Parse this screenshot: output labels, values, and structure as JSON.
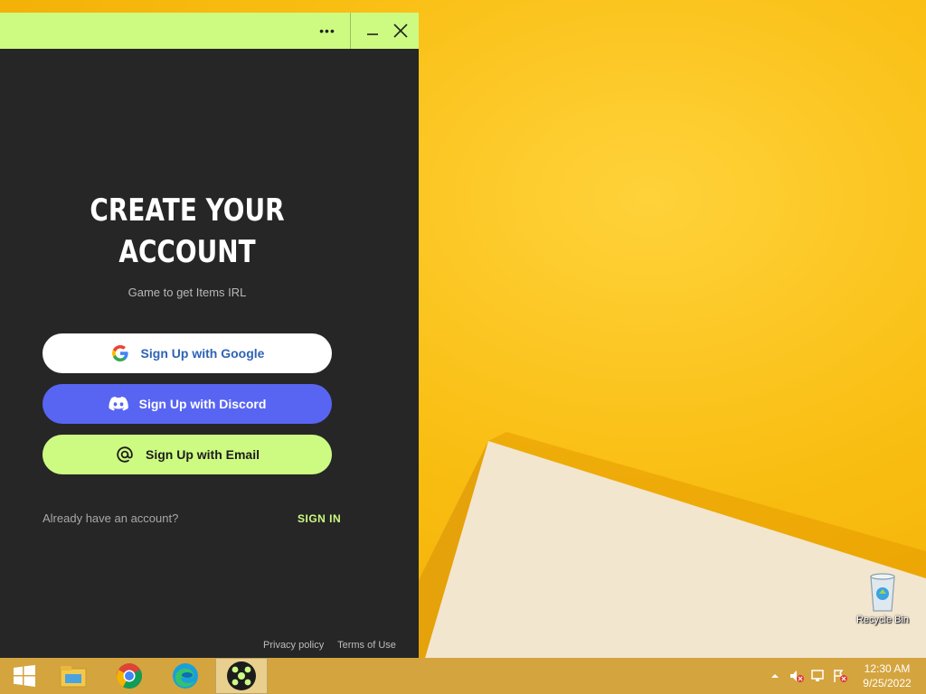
{
  "window": {
    "more_label": "•••",
    "headline_line1": "CREATE YOUR",
    "headline_line2": "ACCOUNT",
    "subtitle": "Game to get Items IRL",
    "buttons": {
      "google": "Sign Up with Google",
      "discord": "Sign Up with Discord",
      "email": "Sign Up with Email"
    },
    "already_text": "Already have an account?",
    "signin_label": "SIGN IN",
    "footer": {
      "privacy": "Privacy policy",
      "terms": "Terms of Use"
    }
  },
  "desktop": {
    "recycle_bin_label": "Recycle Bin"
  },
  "taskbar": {
    "items": [
      "start-icon",
      "file-explorer-icon",
      "chrome-icon",
      "edge-icon",
      "app-icon"
    ],
    "time": "12:30 AM",
    "date": "9/25/2022"
  },
  "colors": {
    "accent_green": "#cdfb82",
    "discord_blue": "#5865f2",
    "panel_dark": "#262626",
    "wallpaper_yellow": "#f9be12"
  }
}
